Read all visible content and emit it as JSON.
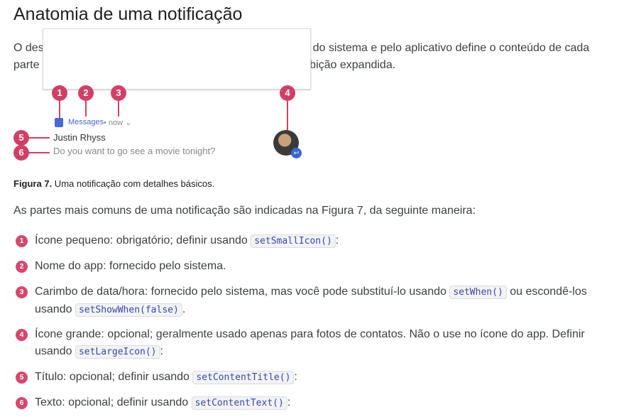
{
  "title": "Anatomia de uma notificação",
  "intro": "O design de uma notificação é determinado pelos modelos do sistema e pelo aplicativo define o conteúdo de cada parte do modelo. Alguns detalhes aparecem apenas na exibição expandida.",
  "figure": {
    "markers": [
      "1",
      "2",
      "3",
      "4",
      "5",
      "6"
    ],
    "app_name": "Messages",
    "when": "• now ⌄",
    "content_title": "Justin Rhyss",
    "content_text": "Do you want to go see a movie tonight?",
    "caption_bold": "Figura 7.",
    "caption": " Uma notificação com detalhes básicos."
  },
  "lead": "As partes mais comuns de uma notificação são indicadas na Figura 7, da seguinte maneira:",
  "items": [
    {
      "num": "1",
      "text": "Ícone pequeno: obrigatório; definir usando ",
      "code": "setSmallIcon()",
      "end": ":"
    },
    {
      "num": "2",
      "text": "Nome do app: fornecido pelo sistema."
    },
    {
      "num": "3",
      "text": "Carimbo de data/hora: fornecido pelo sistema, mas você pode substituí-lo usando ",
      "code": "setWhen()",
      "mid": " ou escondê-los usando ",
      "code2": "setShowWhen(false)",
      "end": "."
    },
    {
      "num": "4",
      "text": "Ícone grande: opcional; geralmente usado apenas para fotos de contatos. Não o use no ícone do app. Definir usando ",
      "code": "setLargeIcon()",
      "end": ":"
    },
    {
      "num": "5",
      "text": "Título: opcional; definir usando ",
      "code": "setContentTitle()",
      "end": ":"
    },
    {
      "num": "6",
      "text": "Texto: opcional; definir usando ",
      "code": "setContentText()",
      "end": ":"
    }
  ]
}
